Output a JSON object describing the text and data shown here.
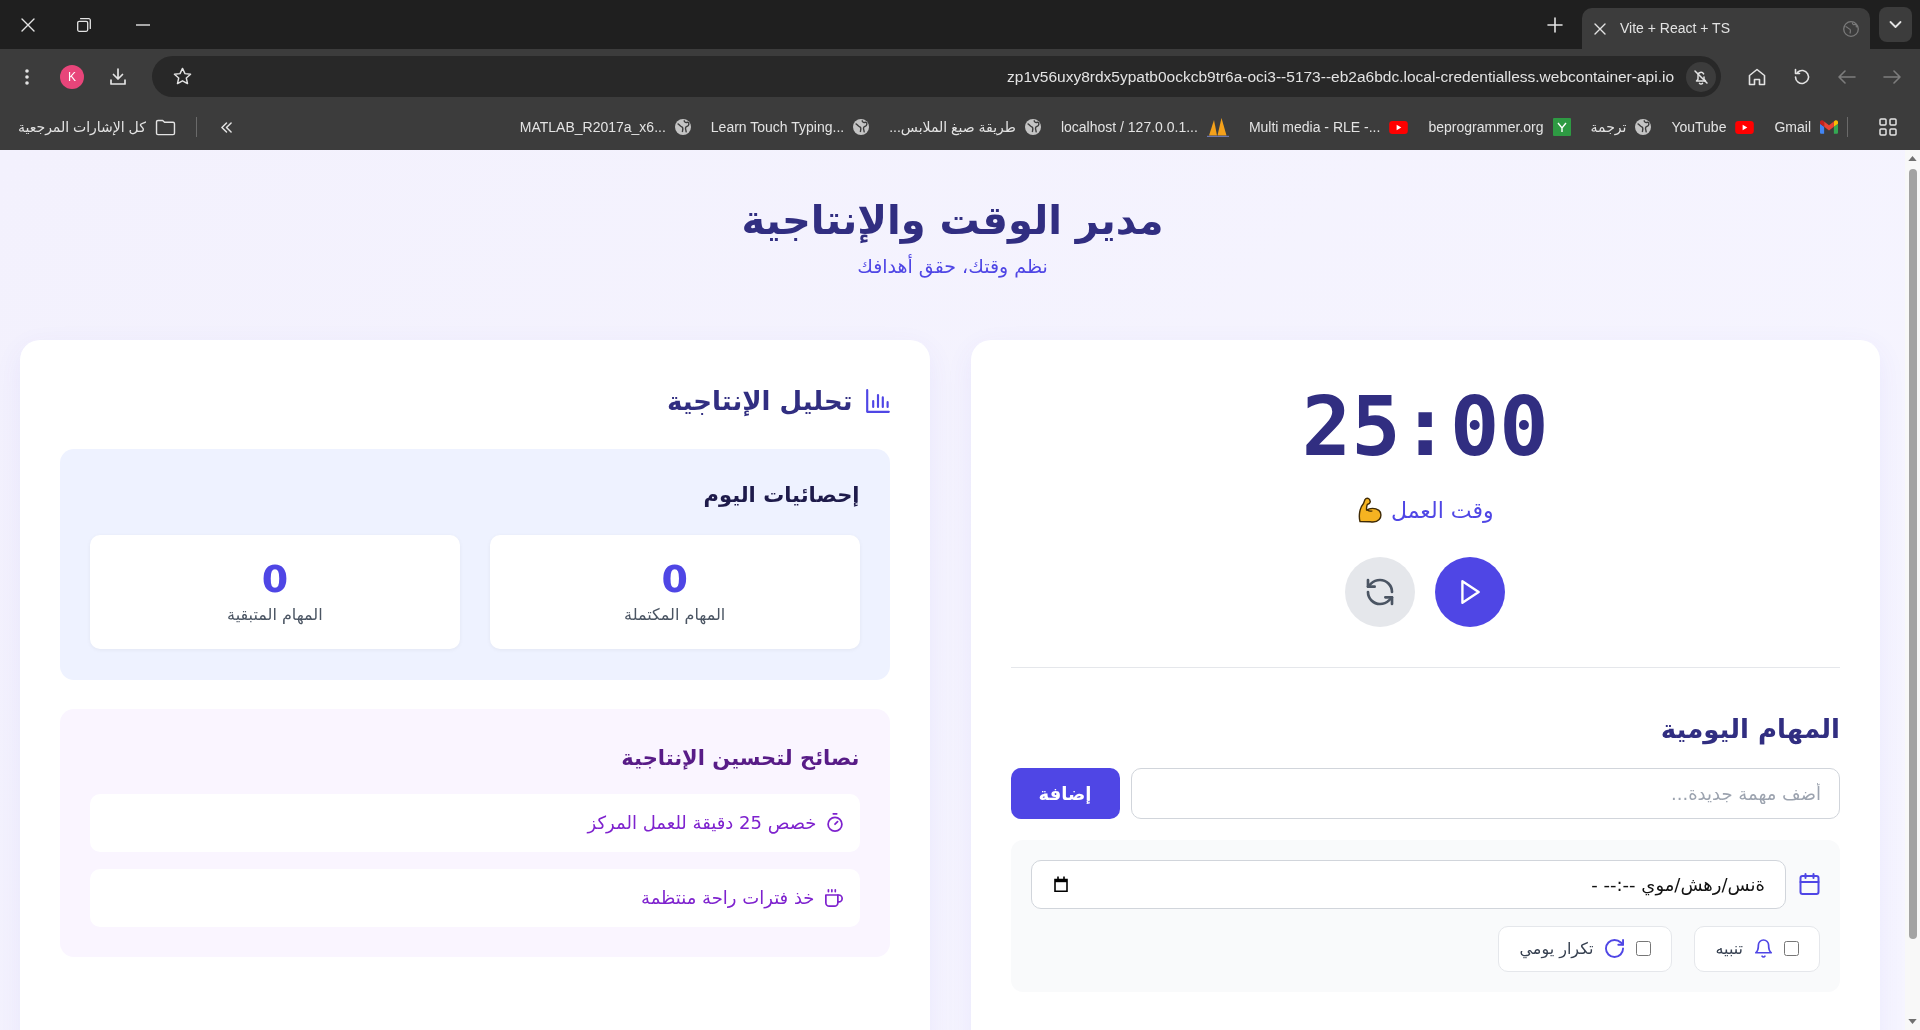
{
  "browser": {
    "tabs": [
      {
        "title": "Vite + React + TS",
        "selected": true
      }
    ],
    "nav_buttons": [
      {
        "kind": "back",
        "disabled": true
      },
      {
        "kind": "forward",
        "disabled": true
      },
      {
        "kind": "reload",
        "disabled": false
      },
      {
        "kind": "home",
        "disabled": false
      }
    ],
    "url": "zp1v56uxy8rdx5ypatb0ockcb9tr6a-oci3--5173--eb2a6bdc.local-credentialless.webcontainer-api.io",
    "profile_initial": "K",
    "bookmarks": [
      {
        "label": "Gmail",
        "kind": "gmail"
      },
      {
        "label": "YouTube",
        "kind": "youtube"
      },
      {
        "label": "ترجمة",
        "kind": "globe"
      },
      {
        "label": "beprogrammer.org",
        "kind": "site"
      },
      {
        "label": "Multi media - RLE -...",
        "kind": "youtube"
      },
      {
        "label": "localhost / 127.0.0.1...",
        "kind": "pma"
      },
      {
        "label": "طريقة صبغ الملابس...",
        "kind": "globe"
      },
      {
        "label": "Learn Touch Typing...",
        "kind": "globe"
      },
      {
        "label": "MATLAB_R2017a_x6...",
        "kind": "globe"
      }
    ],
    "all_bookmarks": "كل الإشارات المرجعية"
  },
  "header": {
    "title": "مدير الوقت والإنتاجية",
    "subtitle": "نظم وقتك، حقق أهدافك"
  },
  "timer": {
    "time": "25:00",
    "mode": "وقت العمل",
    "running": false
  },
  "tasks": {
    "title": "المهام اليومية",
    "input": {
      "placeholder": "أضف مهمة جديدة..."
    },
    "add_button": "إضافة",
    "due_date": {
      "value": "ةنس/رهش/موي --:-- -"
    },
    "options": [
      {
        "kind": "alarm",
        "label": "تنبيه",
        "checked": false
      },
      {
        "kind": "repeat",
        "label": "تكرار يومي",
        "checked": false
      }
    ]
  },
  "analysis": {
    "title": "تحليل الإنتاجية",
    "stats": {
      "title": "إحصائيات اليوم",
      "items": [
        {
          "value": "0",
          "label": "المهام المكتملة"
        },
        {
          "value": "0",
          "label": "المهام المتبقية"
        }
      ]
    },
    "tips": {
      "title": "نصائح لتحسين الإنتاجية",
      "items": [
        {
          "kind": "timer",
          "text": "خصص 25 دقيقة للعمل المركز"
        },
        {
          "kind": "break",
          "text": "خذ فترات راحة منتظمة"
        }
      ]
    }
  }
}
